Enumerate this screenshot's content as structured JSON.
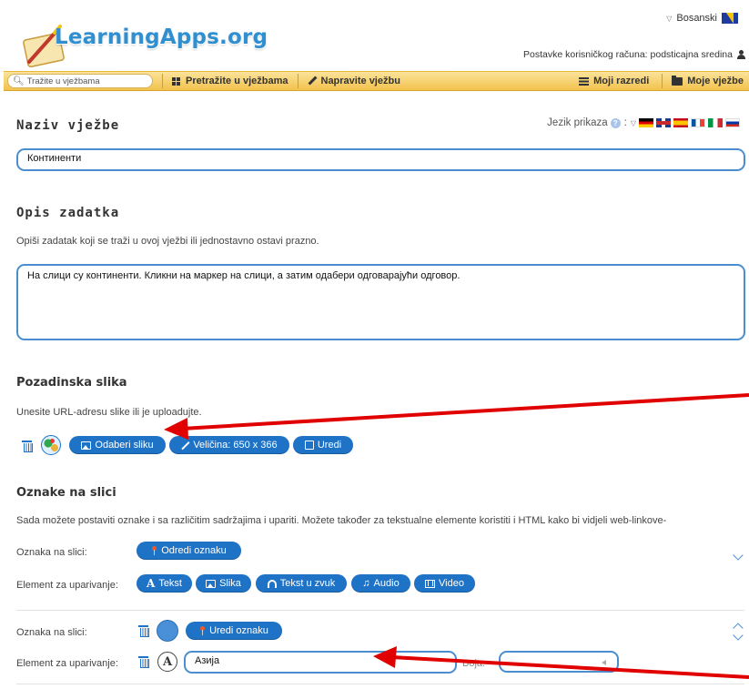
{
  "header": {
    "logo_text": "LearningApps.org",
    "language": "Bosanski",
    "account_text": "Postavke korisničkog računa: podsticajna sredina"
  },
  "navbar": {
    "search_placeholder": "Tražite u vježbama",
    "items": [
      "Pretražite u vježbama",
      "Napravite vježbu",
      "Moji razredi",
      "Moje vježbe"
    ]
  },
  "title_section": {
    "heading": "Naziv vježbe",
    "display_language_label": "Jezik prikaza",
    "help_symbol": "?",
    "title_value": "Континенти"
  },
  "task_section": {
    "heading": "Opis zadatka",
    "description": "Opiši zadatak koji se traži u ovoj vježbi ili jednostavno ostavi prazno.",
    "task_text": "На слици су континенти. Кликни на маркер на слици, а затим одабери одговарајући одговор."
  },
  "background_section": {
    "heading": "Pozadinska slika",
    "description": "Unesite URL-adresu slike ili je uploadujte.",
    "choose_image_label": "Odaberi sliku",
    "size_label": "Veličina: 650 x 366",
    "edit_label": "Uredi"
  },
  "markers_section": {
    "heading": "Oznake na slici",
    "description": "Sada možete postaviti oznake i sa različitim sadržajima i upariti. Možete također za tekstualne elemente koristiti i HTML kako bi vidjeli web-linkove-",
    "marker_label": "Oznaka na slici:",
    "set_marker_label": "Odredi oznaku",
    "pair_label": "Element za uparivanje:",
    "element_buttons": [
      "Tekst",
      "Slika",
      "Tekst u zvuk",
      "Audio",
      "Video"
    ],
    "edit_marker_label": "Uredi oznaku",
    "answer_value": "Азија",
    "color_label": "Boja:"
  },
  "colors": {
    "accent": "#1f73c7",
    "field_border": "#4a8ed0",
    "navbar": "#f2c24d",
    "annotation_arrow": "#e00000"
  }
}
